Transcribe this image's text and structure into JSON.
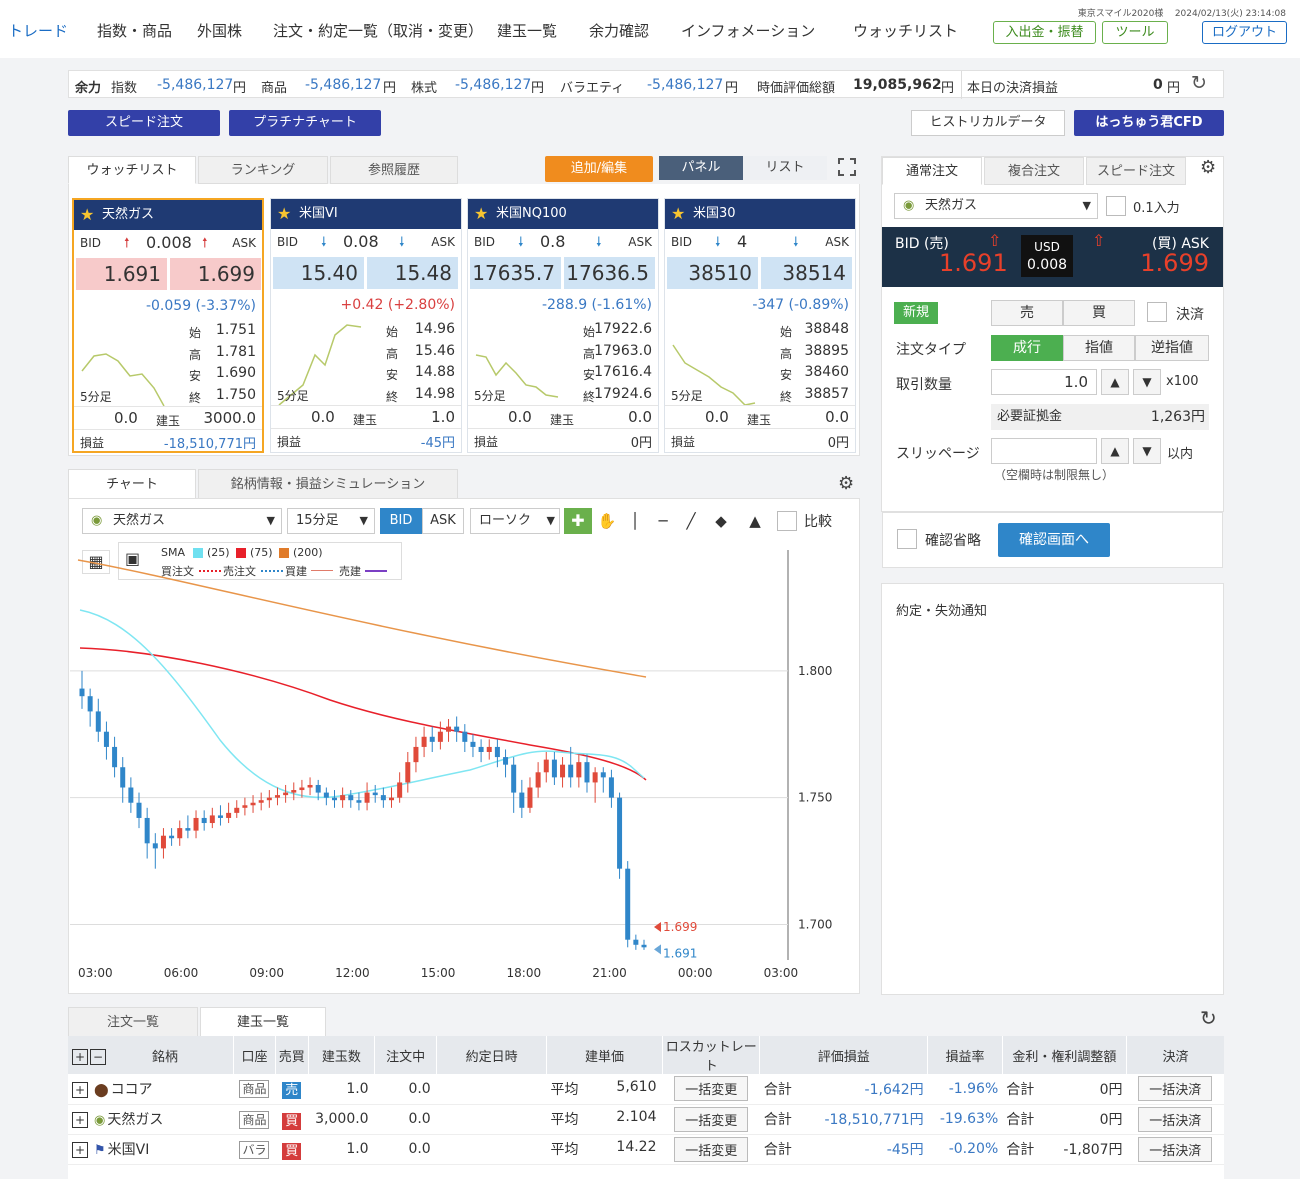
{
  "header": {
    "nav": [
      "トレード",
      "指数・商品",
      "外国株",
      "注文・約定一覧（取消・変更）",
      "建玉一覧",
      "余力確認",
      "インフォメーション",
      "ウォッチリスト"
    ],
    "user": "東京スマイル2020様",
    "datetime": "2024/02/13(火) 23:14:08",
    "deposit_btn": "入出金・振替",
    "tools_btn": "ツール",
    "logout_btn": "ログアウト"
  },
  "info": {
    "yoryoku": "余力",
    "shisu_label": "指数",
    "shisu_value": "-5,486,127",
    "shohin_label": "商品",
    "shohin_value": "-5,486,127",
    "kabu_label": "株式",
    "kabu_value": "-5,486,127",
    "variety_label": "バラエティ",
    "variety_value": "-5,486,127",
    "yen": "円",
    "valuation_label": "時価評価総額",
    "valuation_value": "19,085,962",
    "settle_label": "本日の決済損益",
    "settle_value": "0"
  },
  "buttons": {
    "speed_order": "スピード注文",
    "platinum_chart": "プラチナチャート",
    "historical": "ヒストリカルデータ",
    "hacchukun": "はっちゅう君CFD"
  },
  "watch_tabs": [
    "ウォッチリスト",
    "ランキング",
    "参照履歴"
  ],
  "watch_controls": {
    "add_edit": "追加/編集",
    "panel": "パネル",
    "list": "リスト"
  },
  "cards": [
    {
      "name": "天然ガス",
      "bid_label": "BID",
      "ask_label": "ASK",
      "spread": "0.008",
      "bid": "1.691",
      "ask": "1.699",
      "change": "-0.059 (-3.37%)",
      "open": "1.751",
      "high": "1.781",
      "low": "1.690",
      "close": "1.750",
      "period": "5分足",
      "pos_left": "0.0",
      "tategyoku_label": "建玉",
      "tategyoku": "3000.0",
      "pl_label": "損益",
      "pl": "-18,510,771円",
      "dir": "up"
    },
    {
      "name": "米国VI",
      "bid_label": "BID",
      "ask_label": "ASK",
      "spread": "0.08",
      "bid": "15.40",
      "ask": "15.48",
      "change": "+0.42 (+2.80%)",
      "open": "14.96",
      "high": "15.46",
      "low": "14.88",
      "close": "14.98",
      "period": "5分足",
      "pos_left": "0.0",
      "tategyoku_label": "建玉",
      "tategyoku": "1.0",
      "pl_label": "損益",
      "pl": "-45円",
      "dir": "down"
    },
    {
      "name": "米国NQ100",
      "bid_label": "BID",
      "ask_label": "ASK",
      "spread": "0.8",
      "bid": "17635.7",
      "ask": "17636.5",
      "change": "-288.9 (-1.61%)",
      "open": "17922.6",
      "high": "17963.0",
      "low": "17616.4",
      "close": "17924.6",
      "period": "5分足",
      "pos_left": "0.0",
      "tategyoku_label": "建玉",
      "tategyoku": "0.0",
      "pl_label": "損益",
      "pl": "0円",
      "dir": "down"
    },
    {
      "name": "米国30",
      "bid_label": "BID",
      "ask_label": "ASK",
      "spread": "4",
      "bid": "38510",
      "ask": "38514",
      "change": "-347 (-0.89%)",
      "open": "38848",
      "high": "38895",
      "low": "38460",
      "close": "38857",
      "period": "5分足",
      "pos_left": "0.0",
      "tategyoku_label": "建玉",
      "tategyoku": "0.0",
      "pl_label": "損益",
      "pl": "0円",
      "dir": "down"
    }
  ],
  "ohlc_labels": {
    "open": "始",
    "high": "高",
    "low": "安",
    "close": "終"
  },
  "chart_tabs": [
    "チャート",
    "銘柄情報・損益シミュレーション"
  ],
  "chart_toolbar": {
    "symbol": "天然ガス",
    "interval": "15分足",
    "bid": "BID",
    "ask": "ASK",
    "type": "ローソク",
    "compare": "比較"
  },
  "legend": {
    "sma": "SMA",
    "p1": "(25)",
    "p2": "(75)",
    "p3": "(200)",
    "buy_order": "買注文",
    "sell_order": "売注文",
    "buy_pos": "買建",
    "sell_pos": "売建"
  },
  "chart_data": {
    "type": "candlestick",
    "x_ticks": [
      "03:00",
      "06:00",
      "09:00",
      "12:00",
      "15:00",
      "18:00",
      "21:00",
      "00:00",
      "03:00"
    ],
    "y_ticks": [
      "1.800",
      "1.750",
      "1.700"
    ],
    "ylim": [
      1.686,
      1.85
    ],
    "ask_marker": "1.699",
    "bid_marker": "1.691",
    "ask_value": 1.699,
    "bid_value": 1.691,
    "candles": [
      [
        1.793,
        1.79,
        1.8,
        1.785
      ],
      [
        1.79,
        1.784,
        1.793,
        1.778
      ],
      [
        1.784,
        1.776,
        1.789,
        1.772
      ],
      [
        1.776,
        1.77,
        1.78,
        1.765
      ],
      [
        1.77,
        1.762,
        1.774,
        1.758
      ],
      [
        1.762,
        1.754,
        1.766,
        1.748
      ],
      [
        1.754,
        1.748,
        1.758,
        1.744
      ],
      [
        1.748,
        1.742,
        1.752,
        1.738
      ],
      [
        1.742,
        1.732,
        1.746,
        1.726
      ],
      [
        1.732,
        1.73,
        1.736,
        1.722
      ],
      [
        1.73,
        1.735,
        1.738,
        1.726
      ],
      [
        1.735,
        1.734,
        1.738,
        1.731
      ],
      [
        1.734,
        1.738,
        1.741,
        1.731
      ],
      [
        1.738,
        1.737,
        1.743,
        1.734
      ],
      [
        1.737,
        1.742,
        1.745,
        1.734
      ],
      [
        1.742,
        1.74,
        1.745,
        1.737
      ],
      [
        1.74,
        1.743,
        1.746,
        1.738
      ],
      [
        1.743,
        1.742,
        1.747,
        1.739
      ],
      [
        1.742,
        1.744,
        1.748,
        1.74
      ],
      [
        1.744,
        1.746,
        1.749,
        1.742
      ],
      [
        1.746,
        1.747,
        1.75,
        1.743
      ],
      [
        1.747,
        1.748,
        1.751,
        1.744
      ],
      [
        1.748,
        1.749,
        1.752,
        1.745
      ],
      [
        1.749,
        1.75,
        1.753,
        1.746
      ],
      [
        1.75,
        1.751,
        1.754,
        1.747
      ],
      [
        1.751,
        1.752,
        1.755,
        1.748
      ],
      [
        1.752,
        1.753,
        1.756,
        1.749
      ],
      [
        1.753,
        1.754,
        1.757,
        1.75
      ],
      [
        1.754,
        1.755,
        1.758,
        1.751
      ],
      [
        1.755,
        1.752,
        1.757,
        1.749
      ],
      [
        1.752,
        1.75,
        1.754,
        1.747
      ],
      [
        1.75,
        1.749,
        1.753,
        1.746
      ],
      [
        1.749,
        1.751,
        1.754,
        1.746
      ],
      [
        1.751,
        1.749,
        1.753,
        1.746
      ],
      [
        1.749,
        1.748,
        1.752,
        1.745
      ],
      [
        1.748,
        1.752,
        1.756,
        1.745
      ],
      [
        1.752,
        1.751,
        1.755,
        1.748
      ],
      [
        1.751,
        1.749,
        1.754,
        1.746
      ],
      [
        1.749,
        1.75,
        1.754,
        1.746
      ],
      [
        1.75,
        1.756,
        1.76,
        1.748
      ],
      [
        1.756,
        1.764,
        1.768,
        1.752
      ],
      [
        1.764,
        1.77,
        1.774,
        1.76
      ],
      [
        1.77,
        1.774,
        1.778,
        1.766
      ],
      [
        1.774,
        1.772,
        1.778,
        1.768
      ],
      [
        1.772,
        1.776,
        1.78,
        1.769
      ],
      [
        1.776,
        1.778,
        1.781,
        1.772
      ],
      [
        1.778,
        1.776,
        1.782,
        1.772
      ],
      [
        1.776,
        1.772,
        1.779,
        1.768
      ],
      [
        1.772,
        1.77,
        1.775,
        1.766
      ],
      [
        1.77,
        1.768,
        1.773,
        1.764
      ],
      [
        1.768,
        1.77,
        1.773,
        1.765
      ],
      [
        1.77,
        1.766,
        1.773,
        1.762
      ],
      [
        1.766,
        1.763,
        1.769,
        1.758
      ],
      [
        1.763,
        1.752,
        1.766,
        1.744
      ],
      [
        1.752,
        1.746,
        1.757,
        1.742
      ],
      [
        1.746,
        1.754,
        1.758,
        1.744
      ],
      [
        1.754,
        1.76,
        1.764,
        1.75
      ],
      [
        1.76,
        1.765,
        1.768,
        1.756
      ],
      [
        1.765,
        1.758,
        1.768,
        1.755
      ],
      [
        1.758,
        1.763,
        1.766,
        1.754
      ],
      [
        1.763,
        1.758,
        1.77,
        1.754
      ],
      [
        1.758,
        1.764,
        1.767,
        1.754
      ],
      [
        1.764,
        1.756,
        1.767,
        1.752
      ],
      [
        1.756,
        1.76,
        1.762,
        1.748
      ],
      [
        1.76,
        1.758,
        1.762,
        1.752
      ],
      [
        1.758,
        1.75,
        1.761,
        1.746
      ],
      [
        1.75,
        1.722,
        1.752,
        1.718
      ],
      [
        1.722,
        1.694,
        1.725,
        1.691
      ],
      [
        1.694,
        1.692,
        1.696,
        1.69
      ],
      [
        1.692,
        1.691,
        1.694,
        1.69
      ]
    ]
  },
  "order_panel": {
    "tabs": [
      "通常注文",
      "複合注文",
      "スピード注文"
    ],
    "symbol": "天然ガス",
    "input01": "0.1入力",
    "bid_label": "BID (売)",
    "ask_label": "(買) ASK",
    "currency": "USD",
    "spread": "0.008",
    "bid": "1.691",
    "ask": "1.699",
    "new_label": "新規",
    "sell": "売",
    "buy": "買",
    "settle": "決済",
    "order_type_label": "注文タイプ",
    "market": "成行",
    "limit": "指値",
    "stop": "逆指値",
    "qty_label": "取引数量",
    "qty_value": "1.0",
    "multiplier": "x100",
    "margin_label": "必要証拠金",
    "margin_value": "1,263円",
    "slippage_label": "スリッページ",
    "within": "以内",
    "note": "（空欄時は制限無し）",
    "skip_confirm": "確認省略",
    "confirm_btn": "確認画面へ",
    "notice_title": "約定・失効通知"
  },
  "positions": {
    "tabs": [
      "注文一覧",
      "建玉一覧"
    ],
    "headers": [
      "銘柄",
      "口座",
      "売買",
      "建玉数",
      "注文中",
      "約定日時",
      "建単価",
      "ロスカットレート",
      "評価損益",
      "損益率",
      "金利・権利調整額",
      "決済"
    ],
    "avg": "平均",
    "total": "合計",
    "bulk_change": "一括変更",
    "bulk_settle": "一括決済",
    "rows": [
      {
        "name": "ココア",
        "account": "商品",
        "side": "売",
        "qty": "1.0",
        "pending": "0.0",
        "price": "5,610",
        "pl": "-1,642円",
        "rate": "-1.96%",
        "adj": "0円",
        "side_color": "#2f86c9"
      },
      {
        "name": "天然ガス",
        "account": "商品",
        "side": "買",
        "qty": "3,000.0",
        "pending": "0.0",
        "price": "2.104",
        "pl": "-18,510,771円",
        "rate": "-19.63%",
        "adj": "0円",
        "side_color": "#d43c3c"
      },
      {
        "name": "米国VI",
        "account": "バラ",
        "side": "買",
        "qty": "1.0",
        "pending": "0.0",
        "price": "14.22",
        "pl": "-45円",
        "rate": "-0.20%",
        "adj": "-1,807円",
        "side_color": "#d43c3c"
      }
    ]
  }
}
